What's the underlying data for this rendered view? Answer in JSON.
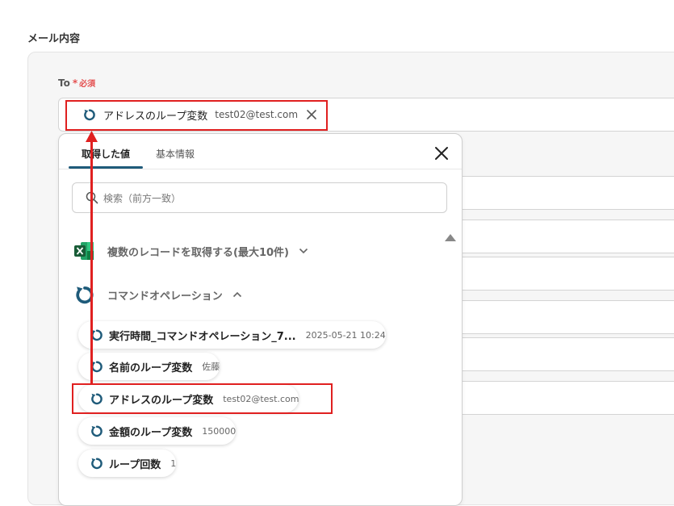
{
  "section": {
    "title": "メール内容"
  },
  "to_field": {
    "label": "To",
    "required_mark": "*",
    "required_text": "必須",
    "chip": {
      "name": "アドレスのループ変数",
      "value": "test02@test.com"
    }
  },
  "dropdown": {
    "tabs": [
      "取得した値",
      "基本情報"
    ],
    "search_placeholder": "検索（前方一致）",
    "groups": [
      {
        "label": "複数のレコードを取得する(最大10件)",
        "icon": "excel-icon",
        "expanded": false
      },
      {
        "label": "コマンドオペレーション",
        "icon": "loop-icon",
        "expanded": true
      }
    ],
    "items": [
      {
        "name": "実行時間_コマンドオペレーション_7...",
        "value": "2025-05-21 10:24"
      },
      {
        "name": "名前のループ変数",
        "value": "佐藤"
      },
      {
        "name": "アドレスのループ変数",
        "value": "test02@test.com"
      },
      {
        "name": "金額のループ変数",
        "value": "150000"
      },
      {
        "name": "ループ回数",
        "value": "1"
      }
    ]
  },
  "colors": {
    "accent": "#1f5b7a",
    "highlight": "#e02020",
    "required": "#e45050"
  }
}
